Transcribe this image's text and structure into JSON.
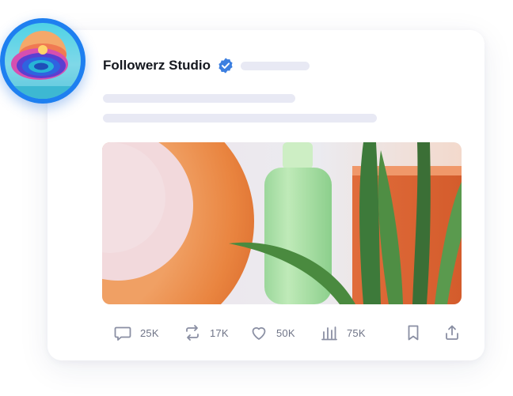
{
  "post": {
    "author_name": "Followerz Studio",
    "verified": true
  },
  "stats": {
    "replies": "25K",
    "reposts": "17K",
    "likes": "50K",
    "views": "75K"
  },
  "colors": {
    "accent": "#1e7ff0",
    "verified_badge": "#3c7fe0",
    "placeholder_bar": "#e8e9f4",
    "icon_gray": "#8a8fa3"
  },
  "icons": {
    "reply": "comment-icon",
    "repost": "repost-icon",
    "like": "heart-icon",
    "views": "bar-chart-icon",
    "bookmark": "bookmark-icon",
    "share": "share-icon"
  }
}
